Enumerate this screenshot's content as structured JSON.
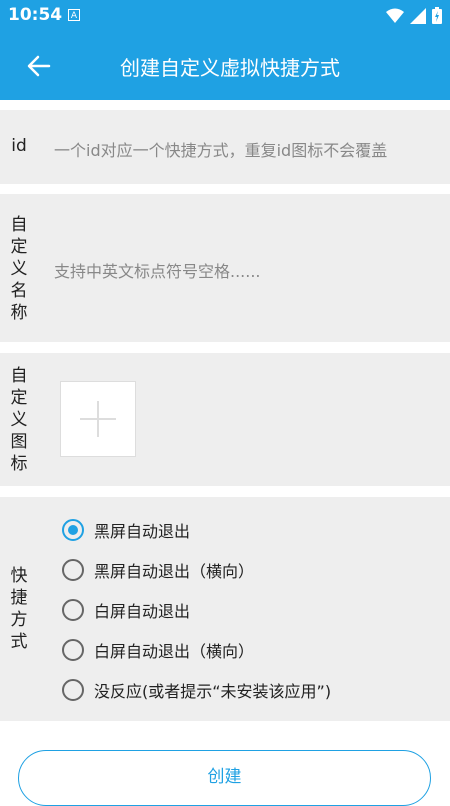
{
  "status_bar": {
    "time": "10:54",
    "notification_icon": "A"
  },
  "app_bar": {
    "title": "创建自定义虚拟快捷方式"
  },
  "id_field": {
    "label": "id",
    "placeholder": "一个id对应一个快捷方式，重复id图标不会覆盖"
  },
  "name_field": {
    "label_chars": [
      "自",
      "定",
      "义",
      "名",
      "称"
    ],
    "placeholder": "支持中英文标点符号空格......"
  },
  "icon_field": {
    "label_chars": [
      "自",
      "定",
      "义",
      "图",
      "标"
    ]
  },
  "shortcut_field": {
    "label_chars": [
      "快",
      "捷",
      "方",
      "式"
    ],
    "options": [
      {
        "label": "黑屏自动退出",
        "checked": true
      },
      {
        "label": "黑屏自动退出（横向）",
        "checked": false
      },
      {
        "label": "白屏自动退出",
        "checked": false
      },
      {
        "label": "白屏自动退出（横向）",
        "checked": false
      },
      {
        "label": "没反应(或者提示“未安装该应用”)",
        "checked": false
      }
    ]
  },
  "create_button": {
    "label": "创建"
  },
  "colors": {
    "primary": "#1fa1e3",
    "section_bg": "#eeeeee",
    "hint": "#888888"
  }
}
